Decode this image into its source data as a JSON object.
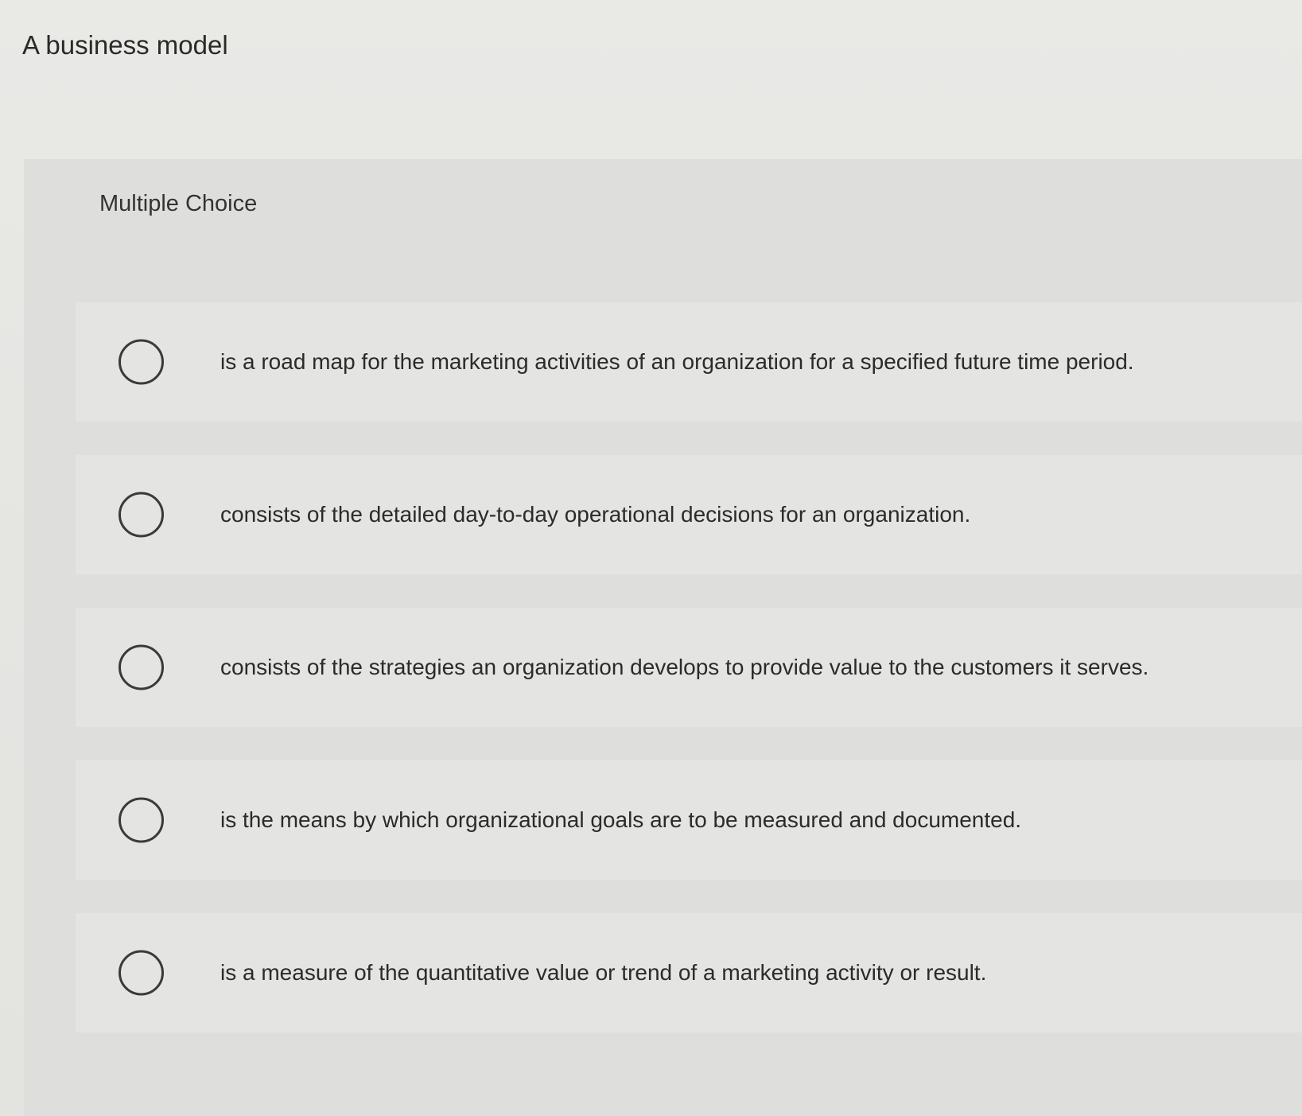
{
  "question": {
    "stem": "A business model"
  },
  "panel": {
    "label": "Multiple Choice"
  },
  "choices": [
    {
      "text": "is a road map for the marketing activities of an organization for a specified future time period.",
      "selected": false
    },
    {
      "text": "consists of the detailed day-to-day operational decisions for an organization.",
      "selected": false
    },
    {
      "text": "consists of the strategies an organization develops to provide value to the customers it serves.",
      "selected": false
    },
    {
      "text": "is the means by which organizational goals are to be measured and documented.",
      "selected": false
    },
    {
      "text": "is a measure of the quantitative value or trend of a marketing activity or result.",
      "selected": false
    }
  ]
}
